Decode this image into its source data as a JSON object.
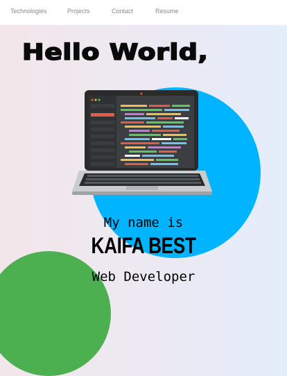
{
  "nav": {
    "items": [
      "Technologies",
      "Projects",
      "Contact",
      "Resume"
    ]
  },
  "hero": {
    "greeting": "Hello World,",
    "intro": "My name is",
    "name": "KAIFA BEST",
    "role": "Web Developer"
  },
  "colors": {
    "blob_primary": "#00b4ff",
    "blob_secondary": "#4caf50",
    "nav_background": "#ffffff"
  },
  "icons": {
    "hero_illustration": "laptop-code-illustration"
  }
}
